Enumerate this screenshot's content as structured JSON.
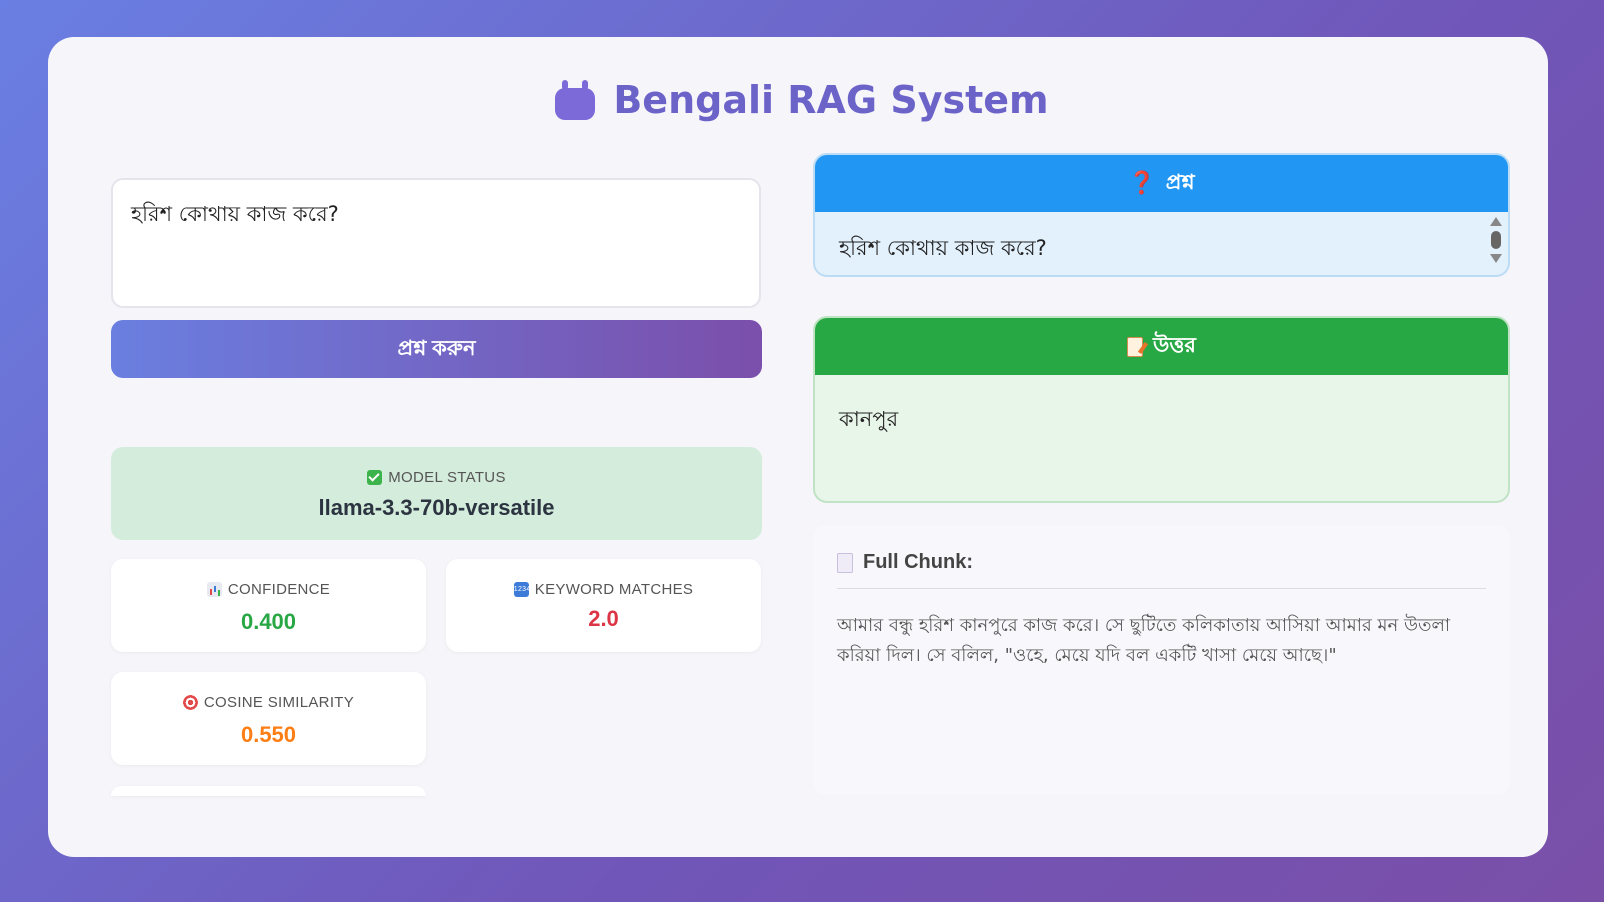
{
  "app": {
    "title": "Bengali RAG System"
  },
  "query": {
    "value": "হরিশ কোথায় কাজ করে?",
    "button_label": "প্রশ্ন করুন"
  },
  "model_status": {
    "label": "MODEL STATUS",
    "value": "llama-3.3-70b-versatile"
  },
  "metrics": [
    {
      "label": "CONFIDENCE",
      "value": "0.400",
      "icon": "bar-chart-icon",
      "color": "#28a745"
    },
    {
      "label": "KEYWORD MATCHES",
      "value": "2.0",
      "icon": "numbers-icon",
      "color": "#dc3545"
    },
    {
      "label": "COSINE SIMILARITY",
      "value": "0.550",
      "icon": "target-icon",
      "color": "#fd7e14"
    }
  ],
  "question_panel": {
    "title": "প্রশ্ন",
    "text": "হরিশ কোথায় কাজ করে?",
    "header_color": "#2196f3"
  },
  "answer_panel": {
    "title": "উত্তর",
    "text": "কানপুর",
    "header_color": "#28a745"
  },
  "chunk": {
    "title": "Full Chunk:",
    "text": "আমার বন্ধু হরিশ কানপুরে কাজ করে। সে ছুটিতে কলিকাতায় আসিয়া আমার মন উতলা করিয়া দিল। সে বলিল, \"ওহে, মেয়ে যদি বল একটি খাসা মেয়ে আছে।\""
  }
}
